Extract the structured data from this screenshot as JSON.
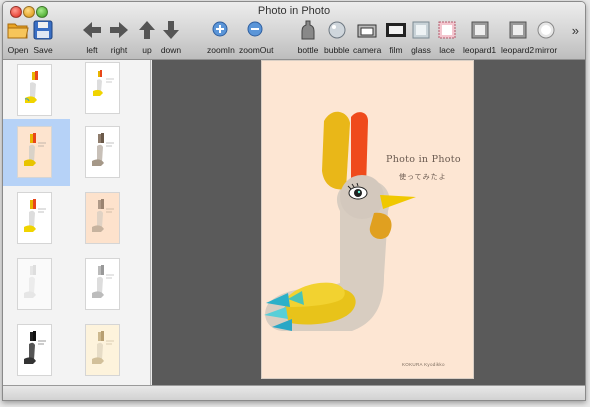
{
  "window": {
    "title": "Photo in Photo"
  },
  "toolbar": {
    "buttons": [
      {
        "label": "Open",
        "icon": "folder-icon"
      },
      {
        "label": "Save",
        "icon": "floppy-disk-icon"
      },
      {
        "label": "left",
        "icon": "arrow-left-icon"
      },
      {
        "label": "right",
        "icon": "arrow-right-icon"
      },
      {
        "label": "up",
        "icon": "arrow-up-icon"
      },
      {
        "label": "down",
        "icon": "arrow-down-icon"
      },
      {
        "label": "zoomIn",
        "icon": "zoom-in-icon"
      },
      {
        "label": "zoomOut",
        "icon": "zoom-out-icon"
      },
      {
        "label": "bottle",
        "icon": "bottle-icon"
      },
      {
        "label": "bubble",
        "icon": "bubble-icon"
      },
      {
        "label": "camera",
        "icon": "camera-icon"
      },
      {
        "label": "film",
        "icon": "film-icon"
      },
      {
        "label": "glass",
        "icon": "glass-icon"
      },
      {
        "label": "lace",
        "icon": "lace-icon"
      },
      {
        "label": "leopard1",
        "icon": "leopard-frame-icon"
      },
      {
        "label": "leopard2",
        "icon": "leopard-frame-icon"
      },
      {
        "label": "mirror",
        "icon": "mirror-icon"
      }
    ],
    "overflow": "»"
  },
  "sidebar": {
    "thumbnails": [
      {
        "variant": "color-white",
        "selected": false
      },
      {
        "variant": "color-white-small",
        "selected": false
      },
      {
        "variant": "color-peach",
        "selected": true
      },
      {
        "variant": "sepia-white",
        "selected": false
      },
      {
        "variant": "color-white",
        "selected": false
      },
      {
        "variant": "sepia-peach",
        "selected": false
      },
      {
        "variant": "faded-white",
        "selected": false
      },
      {
        "variant": "grayscale-white",
        "selected": false
      },
      {
        "variant": "dark-white",
        "selected": false
      },
      {
        "variant": "sepia-cream",
        "selected": false
      }
    ]
  },
  "photo": {
    "title": "Photo in Photo",
    "subtitle": "使ってみたよ",
    "credit": "KOKURA Kyodikko"
  }
}
